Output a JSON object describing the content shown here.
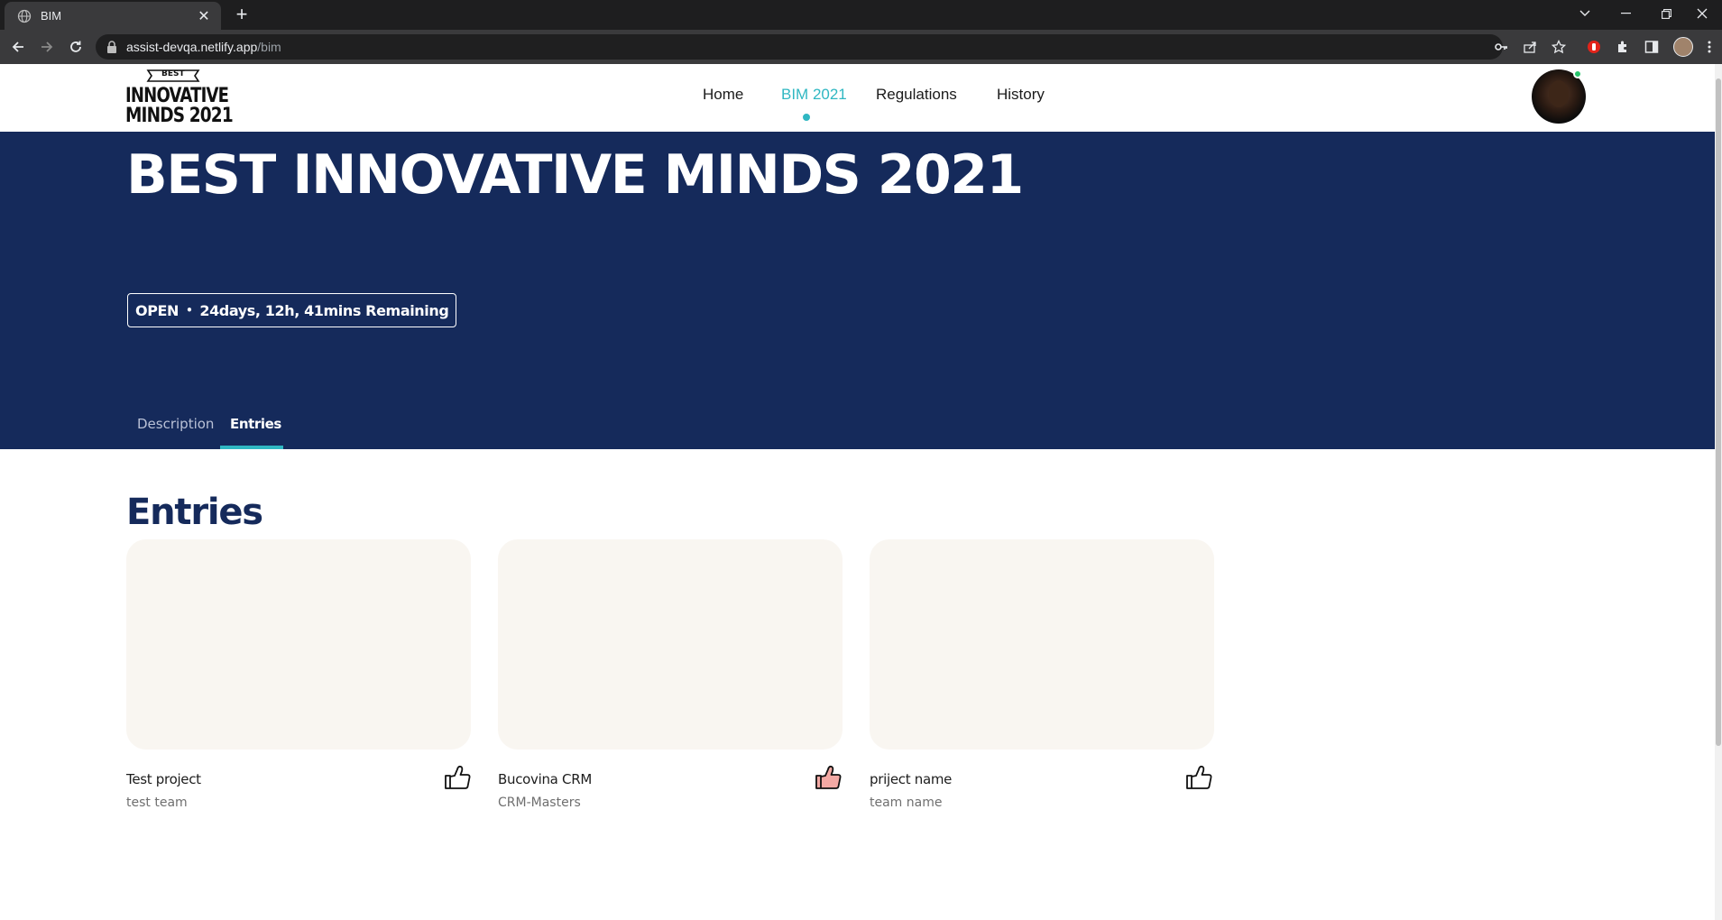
{
  "browser": {
    "tab_title": "BIM",
    "new_tab": "+",
    "url_host": "assist-devqa.netlify.app",
    "url_path": "/bim"
  },
  "site": {
    "logo": {
      "badge": "BEST",
      "line1": "INNOVATIVE",
      "line2": "MINDS 2021"
    },
    "nav": [
      {
        "label": "Home",
        "active": false
      },
      {
        "label": "BIM 2021",
        "active": true
      },
      {
        "label": "Regulations",
        "active": false
      },
      {
        "label": "History",
        "active": false
      }
    ],
    "accent_color": "#2fb7c2",
    "hero_color": "#152a5b"
  },
  "hero": {
    "title": "BEST INNOVATIVE MINDS 2021",
    "status": "OPEN",
    "separator": "•",
    "remaining": "24days, 12h, 41mins Remaining",
    "tabs": [
      {
        "label": "Description",
        "active": false
      },
      {
        "label": "Entries",
        "active": true
      }
    ]
  },
  "entries": {
    "title": "Entries",
    "items": [
      {
        "name": "Test project",
        "team": "test team",
        "liked": false
      },
      {
        "name": "Bucovina CRM",
        "team": "CRM-Masters",
        "liked": true
      },
      {
        "name": "priject name",
        "team": "team name",
        "liked": false
      }
    ]
  }
}
